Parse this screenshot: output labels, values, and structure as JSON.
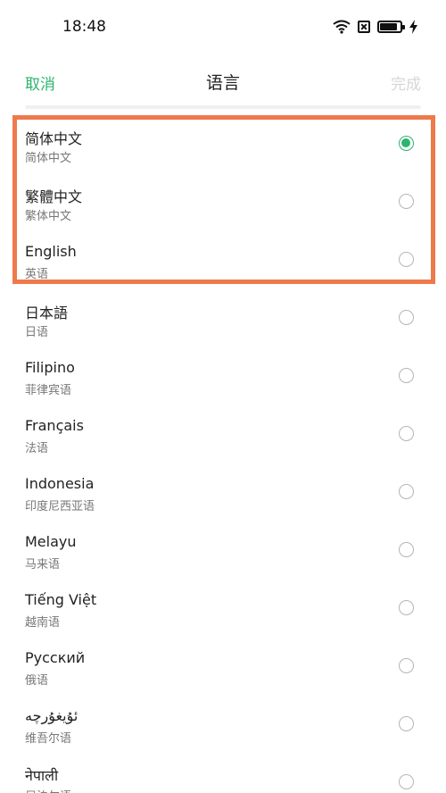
{
  "status_bar": {
    "time": "18:48",
    "icons": [
      "wifi-icon",
      "sim-off-icon",
      "battery-icon",
      "charging-icon"
    ],
    "battery_level_percent": 85
  },
  "nav": {
    "cancel_label": "取消",
    "title": "语言",
    "done_label": "完成"
  },
  "colors": {
    "accent": "#2db46e",
    "highlight": "#ee7a4b",
    "disabled": "#d6d6d6"
  },
  "languages": [
    {
      "name": "简体中文",
      "native": "简体中文",
      "selected": true
    },
    {
      "name": "繁體中文",
      "native": "繁体中文",
      "selected": false
    },
    {
      "name": "English",
      "native": "英语",
      "selected": false
    },
    {
      "name": "日本語",
      "native": "日语",
      "selected": false
    },
    {
      "name": "Filipino",
      "native": "菲律宾语",
      "selected": false
    },
    {
      "name": "Français",
      "native": "法语",
      "selected": false
    },
    {
      "name": "Indonesia",
      "native": "印度尼西亚语",
      "selected": false
    },
    {
      "name": "Melayu",
      "native": "马来语",
      "selected": false
    },
    {
      "name": "Tiếng Việt",
      "native": "越南语",
      "selected": false
    },
    {
      "name": "Русский",
      "native": "俄语",
      "selected": false
    },
    {
      "name": "ئۇيغۇرچە",
      "native": "维吾尔语",
      "selected": false
    },
    {
      "name": "नेपाली",
      "native": "尼泊尔语",
      "selected": false
    }
  ]
}
